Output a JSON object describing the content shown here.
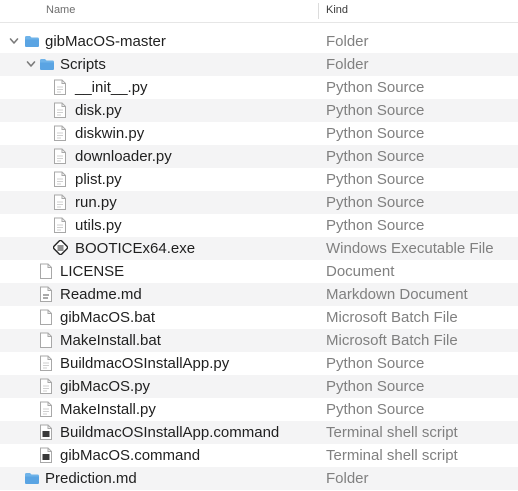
{
  "header": {
    "name_label": "Name",
    "kind_label": "Kind"
  },
  "rows": [
    {
      "name": "gibMacOS-master",
      "kind": "Folder",
      "icon": "folder-icon",
      "level": 0,
      "disclosure": "expanded"
    },
    {
      "name": "Scripts",
      "kind": "Folder",
      "icon": "folder-icon",
      "level": 1,
      "disclosure": "expanded"
    },
    {
      "name": "__init__.py",
      "kind": "Python Source",
      "icon": "python-file-icon",
      "level": 2
    },
    {
      "name": "disk.py",
      "kind": "Python Source",
      "icon": "python-file-icon",
      "level": 2
    },
    {
      "name": "diskwin.py",
      "kind": "Python Source",
      "icon": "python-file-icon",
      "level": 2
    },
    {
      "name": "downloader.py",
      "kind": "Python Source",
      "icon": "python-file-icon",
      "level": 2
    },
    {
      "name": "plist.py",
      "kind": "Python Source",
      "icon": "python-file-icon",
      "level": 2
    },
    {
      "name": "run.py",
      "kind": "Python Source",
      "icon": "python-file-icon",
      "level": 2
    },
    {
      "name": "utils.py",
      "kind": "Python Source",
      "icon": "python-file-icon",
      "level": 2
    },
    {
      "name": "BOOTICEx64.exe",
      "kind": "Windows Executable File",
      "icon": "executable-file-icon",
      "level": 2
    },
    {
      "name": "LICENSE",
      "kind": "Document",
      "icon": "document-icon",
      "level": 1
    },
    {
      "name": "Readme.md",
      "kind": "Markdown Document",
      "icon": "markdown-file-icon",
      "level": 1
    },
    {
      "name": "gibMacOS.bat",
      "kind": "Microsoft Batch File",
      "icon": "document-icon",
      "level": 1
    },
    {
      "name": "MakeInstall.bat",
      "kind": "Microsoft Batch File",
      "icon": "document-icon",
      "level": 1
    },
    {
      "name": "BuildmacOSInstallApp.py",
      "kind": "Python Source",
      "icon": "python-file-icon",
      "level": 1
    },
    {
      "name": "gibMacOS.py",
      "kind": "Python Source",
      "icon": "python-file-icon",
      "level": 1
    },
    {
      "name": "MakeInstall.py",
      "kind": "Python Source",
      "icon": "python-file-icon",
      "level": 1
    },
    {
      "name": "BuildmacOSInstallApp.command",
      "kind": "Terminal shell script",
      "icon": "terminal-script-icon",
      "level": 1
    },
    {
      "name": "gibMacOS.command",
      "kind": "Terminal shell script",
      "icon": "terminal-script-icon",
      "level": 1
    },
    {
      "name": "Prediction.md",
      "kind": "Folder",
      "icon": "folder-icon",
      "level": 0
    }
  ]
}
